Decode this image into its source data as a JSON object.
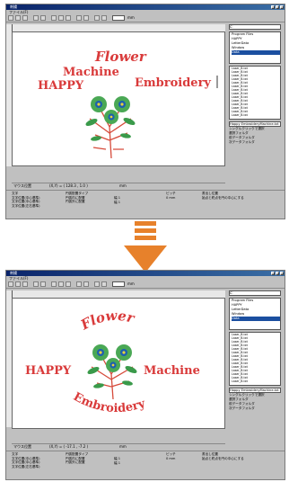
{
  "accent": "#e7812b",
  "app": {
    "title": "刺繍",
    "menu": "ファイル(F)",
    "unit": "mm"
  },
  "before": {
    "words": {
      "line1": "Flower",
      "line2": "Machine",
      "line3": "HAPPY",
      "line4": "Embroidery"
    },
    "status": {
      "label": "マウス位置",
      "coords": "(X,Y) = ( 128.3 , 1.0 )",
      "unit": "mm"
    }
  },
  "after": {
    "words": {
      "line1": "Flower",
      "line2": "HAPPY",
      "line3": "Machine",
      "line4": "Embroidery"
    },
    "status": {
      "label": "マウス位置",
      "coords": "(X,Y) = ( -17.1 , -7.2 )",
      "unit": "mm"
    }
  },
  "sidebar": {
    "drive": "c:",
    "folders": [
      "Program Files",
      "HAPPY",
      "LetterData",
      "Window",
      "Data"
    ],
    "files": [
      "Laser_B.txt",
      "Laser_B.txt",
      "Laser_B.txt",
      "Laser_B.txt",
      "Laser_B.txt",
      "Laser_B.txt",
      "Laser_B.txt",
      "Laser_B.txt",
      "Laser_B.txt",
      "Laser_B.txt",
      "Laser_B.txt",
      "Laser_B.txt",
      "Laser_B.txt",
      "Laser_B.txt"
    ],
    "filename": "Happy EmbroideryMachine.txt",
    "single_click": "シングルクリックで選択",
    "folder_select": "選択フォルダ",
    "opt_prev": "前データフォルダ",
    "opt_next": "次データフォルダ"
  },
  "bottom": {
    "g1_title": "文字",
    "g1_opts": [
      "文字位置(中心基準)",
      "文字位置(中心基準)",
      "文字位置(左右基準)"
    ],
    "g2_title": "円弧配置タイプ",
    "g2_opts": [
      "円弧内に配置",
      "円弧外に配置"
    ],
    "g3": [
      "幅 1",
      "幅 1"
    ],
    "g4_title": "ピッチ",
    "g4_val": "0 mm",
    "g5_title": "書出し位置",
    "g5_check": "始点と終点を円の中心にする"
  }
}
